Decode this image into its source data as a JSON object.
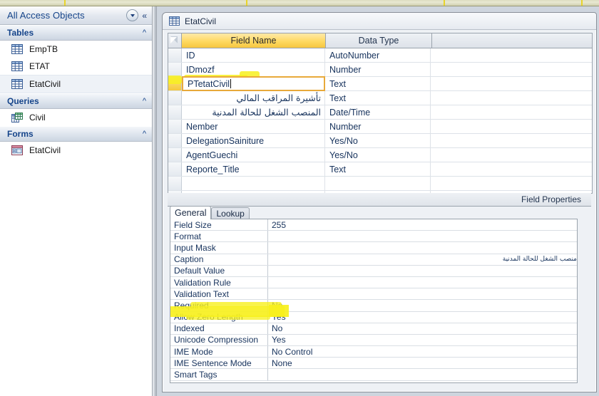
{
  "navpane": {
    "title": "All Access Objects",
    "dropdown_icon": "chevron-down-circle-icon",
    "collapse_icon": "double-chevron-left-icon",
    "groups": [
      {
        "label": "Tables",
        "chevron": "«",
        "items": [
          {
            "label": "EmpTB",
            "icon": "table-icon",
            "selected": false
          },
          {
            "label": "ETAT",
            "icon": "table-icon",
            "selected": false
          },
          {
            "label": "EtatCivil",
            "icon": "table-icon",
            "selected": true
          }
        ]
      },
      {
        "label": "Queries",
        "chevron": "«",
        "items": [
          {
            "label": "Civil",
            "icon": "query-icon",
            "selected": false
          }
        ]
      },
      {
        "label": "Forms",
        "chevron": "«",
        "items": [
          {
            "label": "EtatCivil",
            "icon": "form-icon",
            "selected": false
          }
        ]
      }
    ]
  },
  "document": {
    "tab_label": "EtatCivil",
    "tab_icon": "table-icon",
    "grid": {
      "headers": {
        "field_name": "Field Name",
        "data_type": "Data Type",
        "description": ""
      },
      "rows": [
        {
          "field_name": "ID",
          "data_type": "AutoNumber",
          "rtl": false,
          "current": false
        },
        {
          "field_name": "IDmozf",
          "data_type": "Number",
          "rtl": false,
          "current": false
        },
        {
          "field_name": "PTetatCivil",
          "data_type": "Text",
          "rtl": false,
          "current": true
        },
        {
          "field_name": "تأشيرة المراقب المالي",
          "data_type": "Text",
          "rtl": true,
          "current": false
        },
        {
          "field_name": "المنصب الشغل للحالة المدنية",
          "data_type": "Date/Time",
          "rtl": true,
          "current": false
        },
        {
          "field_name": "Nember",
          "data_type": "Number",
          "rtl": false,
          "current": false
        },
        {
          "field_name": "DelegationSainiture",
          "data_type": "Yes/No",
          "rtl": false,
          "current": false
        },
        {
          "field_name": "AgentGuechi",
          "data_type": "Yes/No",
          "rtl": false,
          "current": false
        },
        {
          "field_name": "Reporte_Title",
          "data_type": "Text",
          "rtl": false,
          "current": false
        },
        {
          "field_name": "",
          "data_type": "",
          "rtl": false,
          "current": false
        },
        {
          "field_name": "",
          "data_type": "",
          "rtl": false,
          "current": false
        }
      ]
    },
    "field_properties": {
      "bar_label": "Field Properties",
      "tabs": [
        {
          "label": "General",
          "active": true
        },
        {
          "label": "Lookup",
          "active": false
        }
      ],
      "rows": [
        {
          "key": "Field Size",
          "value": "255",
          "rtl": false
        },
        {
          "key": "Format",
          "value": "",
          "rtl": false
        },
        {
          "key": "Input Mask",
          "value": "",
          "rtl": false
        },
        {
          "key": "Caption",
          "value": "منصب الشغل للحالة المدنية",
          "rtl": true
        },
        {
          "key": "Default Value",
          "value": "",
          "rtl": false
        },
        {
          "key": "Validation Rule",
          "value": "",
          "rtl": false
        },
        {
          "key": "Validation Text",
          "value": "",
          "rtl": false
        },
        {
          "key": "Required",
          "value": "No",
          "rtl": false
        },
        {
          "key": "Allow Zero Length",
          "value": "Yes",
          "rtl": false
        },
        {
          "key": "Indexed",
          "value": "No",
          "rtl": false
        },
        {
          "key": "Unicode Compression",
          "value": "Yes",
          "rtl": false
        },
        {
          "key": "IME Mode",
          "value": "No Control",
          "rtl": false
        },
        {
          "key": "IME Sentence Mode",
          "value": "None",
          "rtl": false
        },
        {
          "key": "Smart Tags",
          "value": "",
          "rtl": false
        }
      ]
    }
  },
  "colors": {
    "highlighter": "#f7f01e",
    "selected_header": "#ffd962",
    "accent_text": "#15448a",
    "ribbon_tick": "#e8d42a"
  }
}
